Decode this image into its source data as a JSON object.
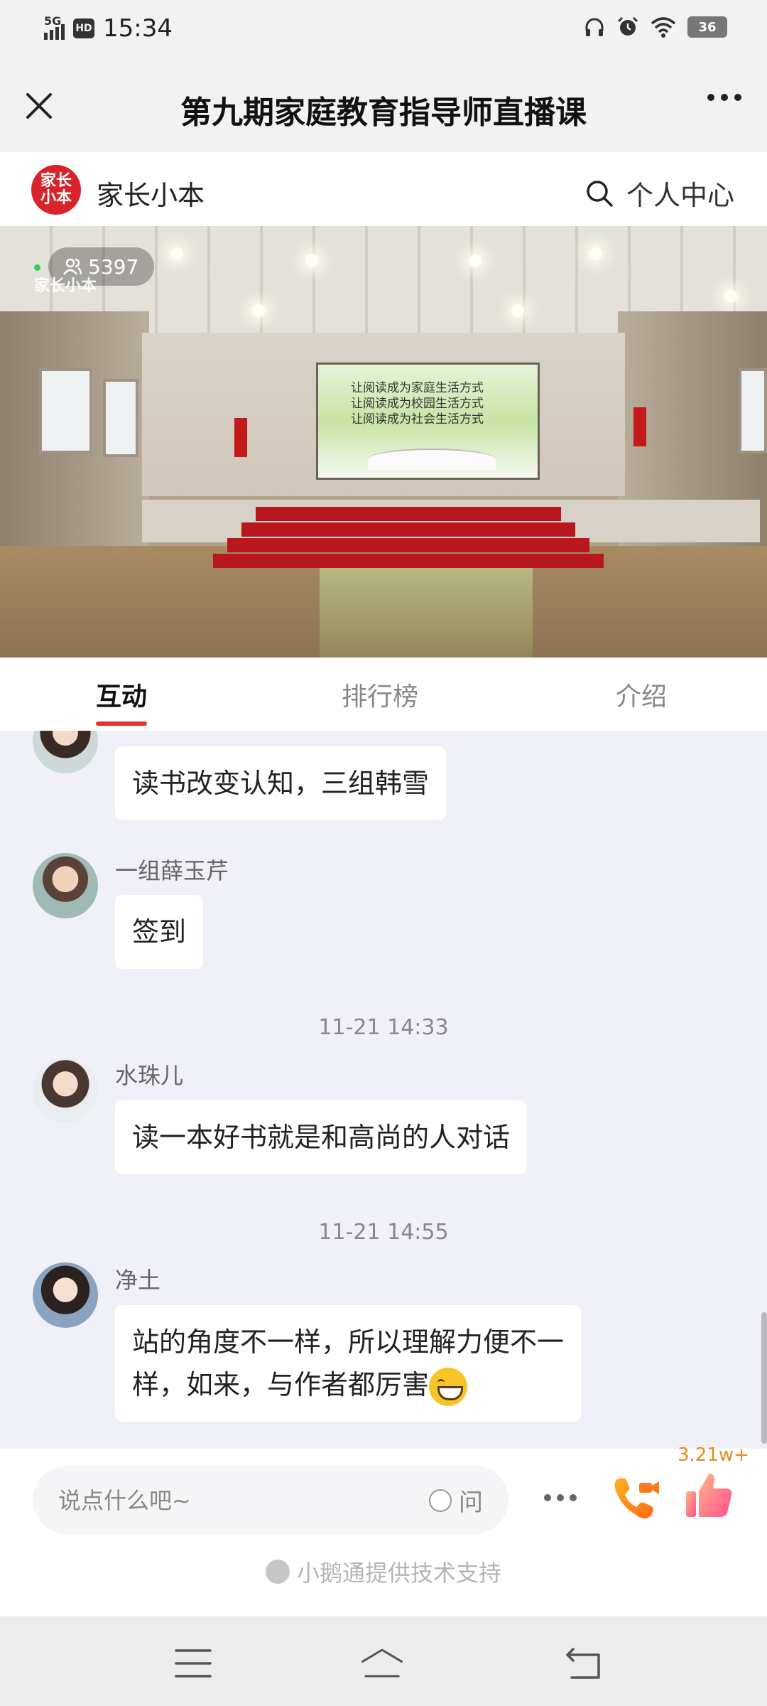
{
  "status_bar": {
    "network": "5G",
    "hd": "HD",
    "time": "15:34",
    "battery": "36"
  },
  "header": {
    "title": "第九期家庭教育指导师直播课",
    "close_icon": "close-icon",
    "more_icon": "more-horizontal-icon"
  },
  "brand": {
    "logo_text": "家长小本",
    "name": "家长小本",
    "user_center": "个人中心"
  },
  "video": {
    "viewer_count": "5397",
    "watermark": "家长小本",
    "screen_lines": [
      "让阅读成为家庭生活方式",
      "让阅读成为校园生活方式",
      "让阅读成为社会生活方式"
    ]
  },
  "tabs": [
    {
      "label": "互动",
      "active": true
    },
    {
      "label": "排行榜",
      "active": false
    },
    {
      "label": "介绍",
      "active": false
    }
  ],
  "messages": [
    {
      "sender": "",
      "text": "读书改变认知，三组韩雪"
    },
    {
      "sender": "一组薛玉芹",
      "text": "签到"
    },
    {
      "timestamp": "11-21 14:33"
    },
    {
      "sender": "水珠儿",
      "text": "读一本好书就是和高尚的人对话"
    },
    {
      "timestamp": "11-21 14:55"
    },
    {
      "sender": "净土",
      "line1": "站的角度不一样，所以理解力便不一",
      "line2": "样，如来，与作者都厉害",
      "emoji": "grinning-face"
    }
  ],
  "input": {
    "placeholder": "说点什么吧~",
    "ask_label": "问",
    "like_count": "3.21w+"
  },
  "footer": {
    "support_text": "小鹅通提供技术支持"
  },
  "colors": {
    "accent_red": "#e3342f",
    "brand_red": "#d8232a",
    "like_orange": "#e88a1a"
  }
}
